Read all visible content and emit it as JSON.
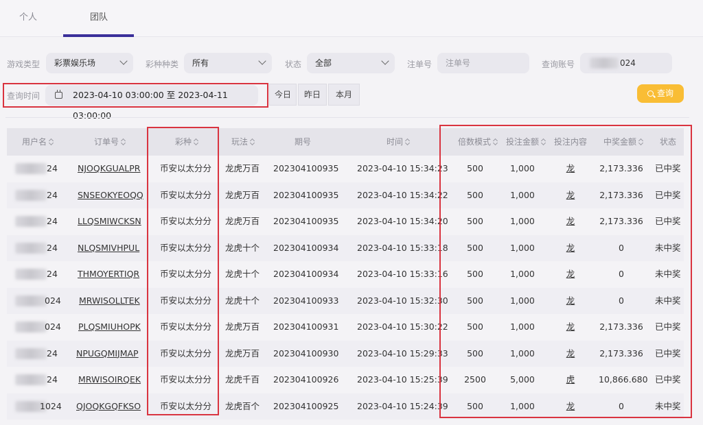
{
  "tabs": [
    {
      "label": "个人"
    },
    {
      "label": "团队"
    }
  ],
  "filters": {
    "game_type_label": "游戏类型",
    "game_type_value": "彩票娱乐场",
    "lottery_type_label": "彩种种类",
    "lottery_type_value": "所有",
    "status_label": "状态",
    "status_value": "全部",
    "order_no_label": "注单号",
    "order_no_placeholder": "注单号",
    "account_label": "查询账号",
    "account_value": "024",
    "time_label": "查询时间",
    "date_range": "2023-04-10 03:00:00 至 2023-04-11 03:00:00",
    "quick": [
      "今日",
      "昨日",
      "本月"
    ],
    "search_label": "查询"
  },
  "table": {
    "headers": [
      "用户名",
      "订单号",
      "彩种",
      "玩法",
      "期号",
      "时间",
      "倍数模式",
      "投注金额",
      "投注内容",
      "中奖金额",
      "状态"
    ],
    "rows": [
      {
        "user": "24",
        "order": "NJOQKGUALPR",
        "lottery": "币安以太分分",
        "play": "龙虎万百",
        "issue": "202304100935",
        "time": "2023-04-10 15:34:23",
        "mult": "500",
        "amount": "1,000",
        "content": "龙",
        "win": "2,173.336",
        "status": "已中奖"
      },
      {
        "user": "24",
        "order": "SNSEOKYEOQQ",
        "lottery": "币安以太分分",
        "play": "龙虎万百",
        "issue": "202304100935",
        "time": "2023-04-10 15:34:22",
        "mult": "500",
        "amount": "1,000",
        "content": "龙",
        "win": "2,173.336",
        "status": "已中奖"
      },
      {
        "user": "24",
        "order": "LLQSMIWCKSN",
        "lottery": "币安以太分分",
        "play": "龙虎万百",
        "issue": "202304100935",
        "time": "2023-04-10 15:34:20",
        "mult": "500",
        "amount": "1,000",
        "content": "龙",
        "win": "2,173.336",
        "status": "已中奖"
      },
      {
        "user": "24",
        "order": "NLQSMIVHPUL",
        "lottery": "币安以太分分",
        "play": "龙虎十个",
        "issue": "202304100934",
        "time": "2023-04-10 15:33:18",
        "mult": "500",
        "amount": "1,000",
        "content": "龙",
        "win": "0",
        "status": "未中奖"
      },
      {
        "user": "24",
        "order": "THMOYERTIQR",
        "lottery": "币安以太分分",
        "play": "龙虎十个",
        "issue": "202304100934",
        "time": "2023-04-10 15:33:16",
        "mult": "500",
        "amount": "1,000",
        "content": "龙",
        "win": "0",
        "status": "未中奖"
      },
      {
        "user": "024",
        "order": "MRWISOLLTEK",
        "lottery": "币安以太分分",
        "play": "龙虎十个",
        "issue": "202304100933",
        "time": "2023-04-10 15:32:30",
        "mult": "500",
        "amount": "1,000",
        "content": "龙",
        "win": "0",
        "status": "未中奖"
      },
      {
        "user": "024",
        "order": "PLQSMIUHOPK",
        "lottery": "币安以太分分",
        "play": "龙虎万百",
        "issue": "202304100931",
        "time": "2023-04-10 15:30:22",
        "mult": "500",
        "amount": "1,000",
        "content": "龙",
        "win": "2,173.336",
        "status": "已中奖"
      },
      {
        "user": "24",
        "order": "NPUGQMIJMAP",
        "lottery": "币安以太分分",
        "play": "龙虎万百",
        "issue": "202304100930",
        "time": "2023-04-10 15:29:33",
        "mult": "500",
        "amount": "1,000",
        "content": "龙",
        "win": "2,173.336",
        "status": "已中奖"
      },
      {
        "user": "24",
        "order": "MRWISOIRQEK",
        "lottery": "币安以太分分",
        "play": "龙虎千百",
        "issue": "202304100926",
        "time": "2023-04-10 15:25:39",
        "mult": "2500",
        "amount": "5,000",
        "content": "虎",
        "win": "10,866.680",
        "status": "已中奖"
      },
      {
        "user": "1024",
        "order": "QJOQKGQFKSO",
        "lottery": "币安以太分分",
        "play": "龙虎百个",
        "issue": "202304100925",
        "time": "2023-04-10 15:24:39",
        "mult": "500",
        "amount": "1,000",
        "content": "龙",
        "win": "0",
        "status": "未中奖"
      }
    ]
  }
}
